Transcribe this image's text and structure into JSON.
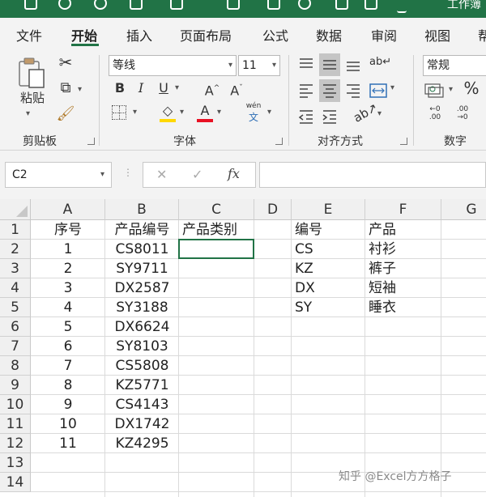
{
  "title_bar": {
    "right_text": "工作簿"
  },
  "ribbon": {
    "tabs": [
      "文件",
      "开始",
      "插入",
      "页面布局",
      "公式",
      "数据",
      "审阅",
      "视图",
      "帮"
    ],
    "active_tab": "开始",
    "groups": {
      "clipboard": {
        "label": "剪贴板",
        "paste_label": "粘贴"
      },
      "font": {
        "label": "字体",
        "font_name": "等线",
        "font_size": "11",
        "bold": "B",
        "italic": "I",
        "underline": "U",
        "grow": "A",
        "shrink": "A",
        "phonetic_top": "wén",
        "phonetic_bottom": "文",
        "font_color": "#e81123",
        "fill_color": "#ffd800"
      },
      "alignment": {
        "label": "对齐方式",
        "wrap": "ab"
      },
      "number": {
        "label": "数字",
        "format": "常规",
        "percent": "%",
        "dec_inc": "←0 .00",
        "dec_dec": ".00 →0"
      }
    },
    "accent": "#217346"
  },
  "formula_bar": {
    "name_box": "C2",
    "fx": "fx",
    "cancel": "✕",
    "enter": "✓",
    "value": ""
  },
  "sheet": {
    "columns": [
      "A",
      "B",
      "C",
      "D",
      "E",
      "F",
      "G"
    ],
    "rows": [
      "1",
      "2",
      "3",
      "4",
      "5",
      "6",
      "7",
      "8",
      "9",
      "10",
      "11",
      "12",
      "13",
      "14"
    ],
    "header_row": {
      "A": "序号",
      "B": "产品编号",
      "C": "产品类别",
      "E": "编号",
      "F": "产品"
    },
    "data_A": [
      "1",
      "2",
      "3",
      "4",
      "5",
      "6",
      "7",
      "8",
      "9",
      "10",
      "11"
    ],
    "data_B": [
      "CS8011",
      "SY9711",
      "DX2587",
      "SY3188",
      "DX6624",
      "SY8103",
      "CS5808",
      "KZ5771",
      "CS4143",
      "DX1742",
      "KZ4295"
    ],
    "data_E": [
      "CS",
      "KZ",
      "DX",
      "SY"
    ],
    "data_F": [
      "衬衫",
      "裤子",
      "短袖",
      "睡衣"
    ],
    "selected_cell": "C2"
  },
  "watermark": "知乎 @Excel方方格子"
}
